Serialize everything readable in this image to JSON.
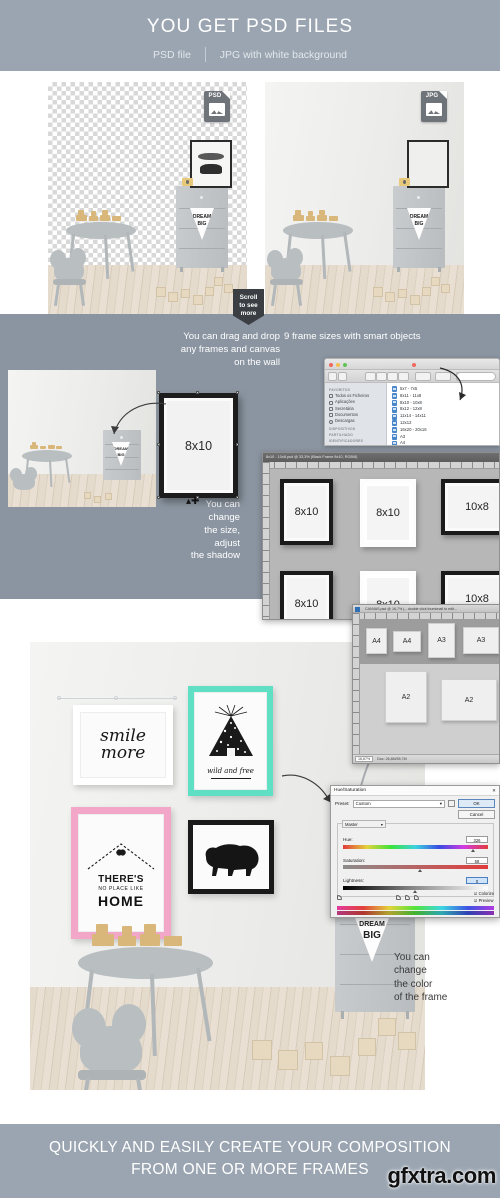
{
  "header": {
    "title": "YOU GET PSD FILES",
    "sub_left": "PSD file",
    "sub_right": "JPG with white background"
  },
  "section1": {
    "left_badge": "PSD",
    "right_badge": "JPG",
    "scroll_badge": "Scroll\nto see\nmore",
    "scroll_badge_lines": [
      "Scroll",
      "to see",
      "more"
    ]
  },
  "section2": {
    "caption_left": "You can drag and drop\nany frames  and canvas\non the wall",
    "caption_left_lines": [
      "You can drag and drop",
      "any frames  and canvas",
      "on the wall"
    ],
    "caption_right": "9 frame sizes with smart objects",
    "caption_bottom_lines": [
      "You can",
      "change",
      "the size,",
      "adjust",
      "the shadow"
    ],
    "drag_frame_label": "8x10",
    "finder": {
      "sidebar_groups": [
        "FAVORITOS",
        "DISPOSITIVOS",
        "PARTILHADO",
        "IDENTIFICADORES"
      ],
      "sidebar_items": [
        "Todos os Ficheiros",
        "Aplicações",
        "Secretária",
        "Documentos",
        "Descargas"
      ],
      "files": [
        "5x7 - 7x5",
        "8x11 - 11x8",
        "8x10 - 10x8",
        "8x12 - 12x8",
        "11x14 - 14x11",
        "12x12",
        "16x20 - 20x16",
        "A3",
        "A4"
      ]
    },
    "frames_window": {
      "title": "8x10 - 10x8.psd @ 33,3% (Black Frame 8x10, RGB/8)",
      "frames": [
        "8x10",
        "8x10",
        "10x8",
        "8x10",
        "8x10",
        "10x8"
      ]
    },
    "canvas_window": {
      "title": "CANVAS.psd @ 16,7% (-- double click thumbnail to edit...",
      "canvases": [
        "A4",
        "A4",
        "A3",
        "A3",
        "A2",
        "A2"
      ],
      "zoom": "16,67%",
      "doc_info": "Doc: 26,8M/55,7M"
    }
  },
  "section3": {
    "prints": [
      {
        "label": "smile more",
        "frame_color": "#ffffff",
        "frame_name": "white-frame"
      },
      {
        "label": "wild and free",
        "frame_color": "#5fe0c4",
        "frame_name": "mint-frame"
      },
      {
        "label": "THERE'S NO PLACE LIKE HOME",
        "frame_color": "#f2a6c8",
        "frame_name": "pink-frame"
      },
      {
        "label": "bear",
        "frame_color": "#1a1a1a",
        "frame_name": "black-frame"
      }
    ],
    "print_text": {
      "smile_line1": "smile",
      "smile_line2": "more",
      "wild_caption": "wild and free",
      "home_line1": "THERE'S",
      "home_line2": "NO PLACE LIKE",
      "home_line3": "HOME",
      "pennant": "DREAM BIG",
      "pennant_line1": "DREAM",
      "pennant_line2": "BIG"
    },
    "caption_color_lines": [
      "You can",
      "change",
      "the color",
      "of the frame"
    ],
    "hue_dialog": {
      "title": "Hue/Saturation",
      "close": "✕",
      "preset_label": "Preset:",
      "preset_value": "Custom",
      "channel_value": "Master",
      "ok": "OK",
      "cancel": "Cancel",
      "hue_label": "Hue:",
      "hue_value": "326",
      "sat_label": "Saturation:",
      "sat_value": "58",
      "light_label": "Lightness:",
      "light_value": "0",
      "colorize": "Colorize",
      "preview": "Preview"
    }
  },
  "footer": {
    "line1": "QUICKLY AND EASILY CREATE YOUR COMPOSITION",
    "line2": "FROM ONE OR MORE FRAMES",
    "watermark": "gfxtra.com"
  },
  "colors": {
    "band": "#9aa5b1",
    "band_mid": "#8b95a1",
    "mint": "#5fe0c4",
    "pink": "#f2a6c8"
  }
}
